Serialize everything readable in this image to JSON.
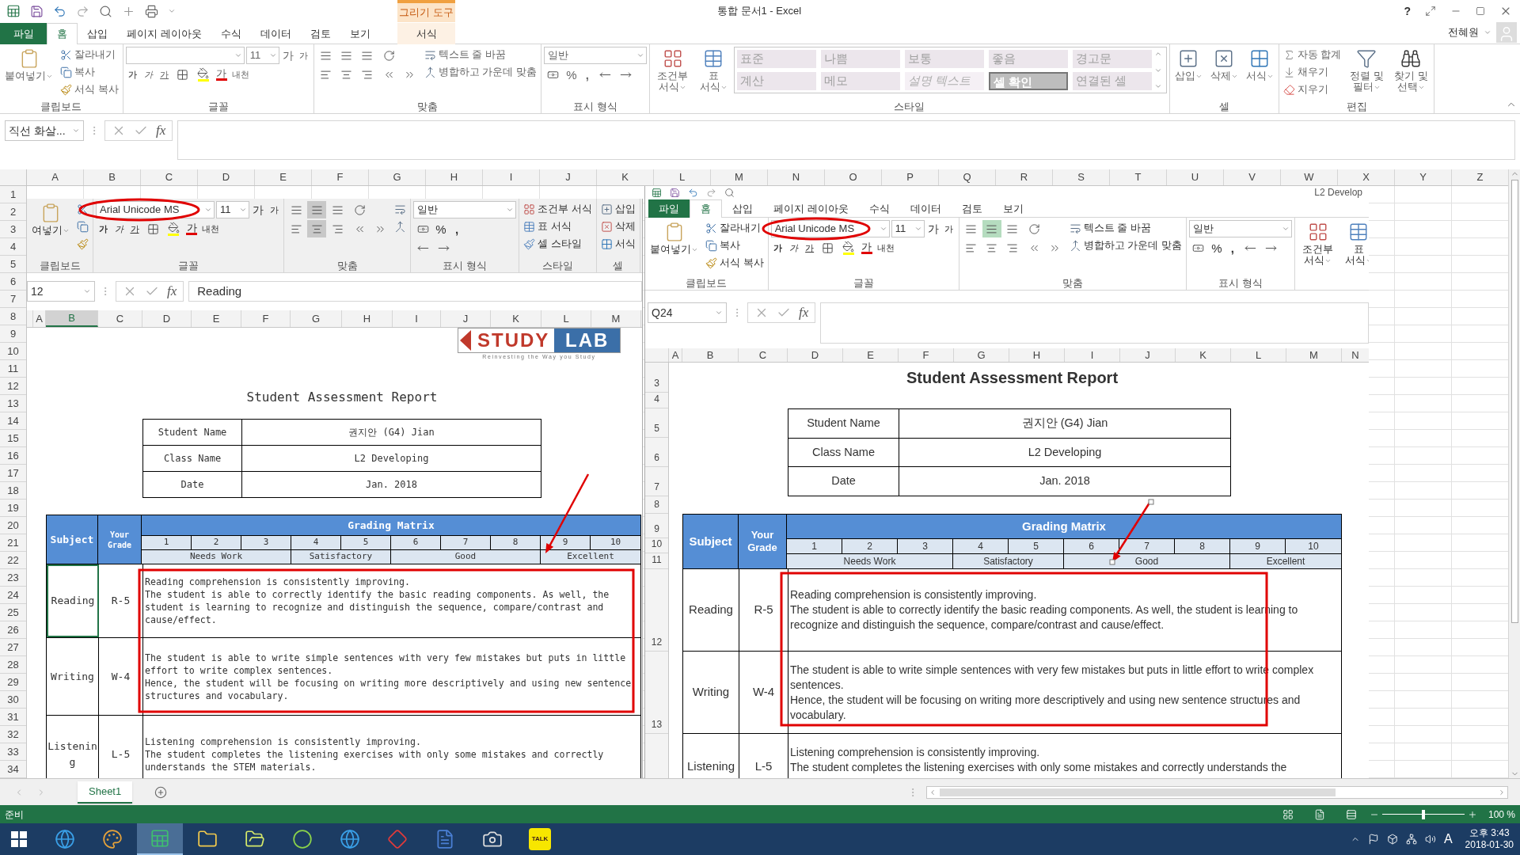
{
  "title_bar": {
    "contextual_group": "그리기 도구",
    "title": "통합 문서1 - Excel",
    "help": "?",
    "user": "전혜원"
  },
  "tabs": [
    {
      "label": "파일",
      "kind": "file",
      "selected": false
    },
    {
      "label": "홈",
      "kind": "normal",
      "selected": true
    },
    {
      "label": "삽입",
      "kind": "normal",
      "selected": false
    },
    {
      "label": "페이지 레이아웃",
      "kind": "normal",
      "selected": false
    },
    {
      "label": "수식",
      "kind": "normal",
      "selected": false
    },
    {
      "label": "데이터",
      "kind": "normal",
      "selected": false
    },
    {
      "label": "검토",
      "kind": "normal",
      "selected": false
    },
    {
      "label": "보기",
      "kind": "normal",
      "selected": false
    },
    {
      "label": "서식",
      "kind": "contextual",
      "selected": false
    }
  ],
  "ribbon": {
    "groups": [
      {
        "label": "클립보드",
        "cols": [
          [
            [
              {
                "kind": "paste",
                "label": "붙여넣기"
              }
            ]
          ],
          [
            [
              {
                "kind": "cut",
                "label": "잘라내기"
              }
            ],
            [
              {
                "kind": "copy",
                "label": "복사"
              }
            ],
            [
              {
                "kind": "painter",
                "label": "서식 복사"
              }
            ]
          ]
        ]
      },
      {
        "label": "글꼴",
        "cols": [
          [
            [
              {
                "kind": "font-box"
              },
              {
                "kind": "size-box",
                "value": "11"
              },
              {
                "kind": "grow",
                "label": "가"
              },
              {
                "kind": "shrink",
                "label": "가"
              }
            ],
            [
              {
                "kind": "bold",
                "label": "가"
              },
              {
                "kind": "italic",
                "label": "가"
              },
              {
                "kind": "underline",
                "label": "가"
              },
              {
                "kind": "borders"
              },
              {
                "kind": "fill-color"
              },
              {
                "kind": "font-color",
                "label": "가"
              },
              {
                "kind": "phonetic",
                "label": "내천"
              }
            ]
          ]
        ]
      },
      {
        "label": "맞춤",
        "cols": [
          [
            [
              {
                "kind": "align-top",
                "selected": false
              },
              {
                "kind": "align-middle",
                "selected": false
              },
              {
                "kind": "align-bottom",
                "selected": false
              }
            ],
            [
              {
                "kind": "align-left",
                "selected": false
              },
              {
                "kind": "align-center",
                "selected": false
              },
              {
                "kind": "align-right",
                "selected": false
              }
            ]
          ],
          [
            [
              {
                "kind": "orient"
              }
            ],
            [
              {
                "kind": "indent-dec"
              },
              {
                "kind": "indent-inc"
              }
            ]
          ],
          [
            [
              {
                "kind": "wrap",
                "label": "텍스트 줄 바꿈"
              }
            ],
            [
              {
                "kind": "merge",
                "label": "병합하고 가운데 맞춤"
              }
            ]
          ]
        ]
      },
      {
        "label": "표시 형식",
        "cols": [
          [
            [
              {
                "kind": "number-box",
                "value": "일반"
              }
            ],
            [
              {
                "kind": "currency"
              },
              {
                "kind": "percent",
                "label": "%"
              },
              {
                "kind": "comma",
                "label": ","
              },
              {
                "kind": "dec-inc"
              },
              {
                "kind": "dec-dec"
              }
            ]
          ]
        ]
      },
      {
        "label": "스타일",
        "cols": [
          [
            [
              {
                "kind": "cond",
                "label": "조건부 서식"
              }
            ]
          ],
          [
            [
              {
                "kind": "table-fmt",
                "label": "표 서식"
              }
            ]
          ],
          [
            [
              {
                "kind": "gallery",
                "styles": [
                  {
                    "label": "표준",
                    "kind": "plain"
                  },
                  {
                    "label": "나쁨",
                    "kind": "plain"
                  },
                  {
                    "label": "보통",
                    "kind": "plain"
                  },
                  {
                    "label": "좋음",
                    "kind": "plain"
                  },
                  {
                    "label": "경고문",
                    "kind": "plain"
                  },
                  {
                    "label": "계산",
                    "kind": "plain"
                  },
                  {
                    "label": "메모",
                    "kind": "plain"
                  },
                  {
                    "label": "설명 텍스트",
                    "kind": "italic"
                  },
                  {
                    "label": "셀 확인",
                    "kind": "check"
                  },
                  {
                    "label": "연결된 셀",
                    "kind": "plain"
                  }
                ]
              }
            ]
          ]
        ]
      },
      {
        "label": "셀",
        "cols": [
          [
            [
              {
                "kind": "insert",
                "label": "삽입"
              }
            ]
          ],
          [
            [
              {
                "kind": "delete",
                "label": "삭제"
              }
            ]
          ],
          [
            [
              {
                "kind": "format",
                "label": "서식"
              }
            ]
          ]
        ]
      },
      {
        "label": "편집",
        "cols": [
          [
            [
              {
                "kind": "autosum",
                "label": "자동 합계"
              }
            ],
            [
              {
                "kind": "fill",
                "label": "채우기"
              }
            ],
            [
              {
                "kind": "clear",
                "label": "지우기"
              }
            ]
          ],
          [
            [
              {
                "kind": "sort",
                "label": "정렬 및 필터"
              }
            ]
          ],
          [
            [
              {
                "kind": "find",
                "label": "찾기 및 선택"
              }
            ]
          ]
        ]
      }
    ]
  },
  "formula_bar": {
    "name_box": "직선 화살...",
    "function_label": "fx"
  },
  "sheet": {
    "columns": [
      "A",
      "B",
      "C",
      "D",
      "E",
      "F",
      "G",
      "H",
      "I",
      "J",
      "K",
      "L",
      "M",
      "N",
      "O",
      "P",
      "Q",
      "R",
      "S",
      "T",
      "U",
      "V",
      "W",
      "X",
      "Y",
      "Z"
    ],
    "rows": [
      "1",
      "2",
      "3",
      "4",
      "5",
      "6",
      "7",
      "8",
      "9",
      "10",
      "11",
      "12",
      "13",
      "14",
      "15",
      "16",
      "17",
      "18",
      "19",
      "20",
      "21",
      "22",
      "23",
      "24",
      "25",
      "26",
      "27",
      "28",
      "29",
      "30",
      "31",
      "32",
      "33",
      "34"
    ]
  },
  "left_screenshot": {
    "ribbon": {
      "groups": [
        {
          "label": "클립보드",
          "cols": [
            [
              [
                {
                  "kind": "paste",
                  "label": "여넣기"
                }
              ]
            ],
            [
              [
                {
                  "kind": "cut"
                }
              ],
              [
                {
                  "kind": "copy"
                }
              ],
              [
                {
                  "kind": "painter"
                }
              ]
            ]
          ]
        },
        {
          "label": "글꼴",
          "cols": [
            [
              [
                {
                  "kind": "font-box",
                  "value": "Arial Unicode MS"
                },
                {
                  "kind": "size-box",
                  "value": "11"
                },
                {
                  "kind": "grow",
                  "label": "가"
                },
                {
                  "kind": "shrink",
                  "label": "가"
                }
              ],
              [
                {
                  "kind": "bold",
                  "label": "가"
                },
                {
                  "kind": "italic",
                  "label": "가"
                },
                {
                  "kind": "underline",
                  "label": "가"
                },
                {
                  "kind": "borders"
                },
                {
                  "kind": "fill-color"
                },
                {
                  "kind": "font-color",
                  "label": "가"
                },
                {
                  "kind": "phonetic",
                  "label": "내천"
                }
              ]
            ]
          ]
        },
        {
          "label": "맞춤",
          "cols": [
            [
              [
                {
                  "kind": "align-top",
                  "selected": false
                },
                {
                  "kind": "align-middle",
                  "selected": true
                },
                {
                  "kind": "align-bottom",
                  "selected": false
                }
              ],
              [
                {
                  "kind": "align-left",
                  "selected": false
                },
                {
                  "kind": "align-center",
                  "selected": true
                },
                {
                  "kind": "align-right",
                  "selected": false
                }
              ]
            ],
            [
              [
                {
                  "kind": "orient"
                }
              ],
              [
                {
                  "kind": "indent-dec"
                },
                {
                  "kind": "indent-inc"
                }
              ]
            ],
            [
              [
                {
                  "kind": "wrap"
                }
              ],
              [
                {
                  "kind": "merge"
                }
              ]
            ]
          ]
        },
        {
          "label": "표시 형식",
          "cols": [
            [
              [
                {
                  "kind": "number-box",
                  "value": "일반"
                }
              ],
              [
                {
                  "kind": "currency"
                },
                {
                  "kind": "percent",
                  "label": "%"
                },
                {
                  "kind": "comma",
                  "label": ","
                }
              ],
              [
                {
                  "kind": "dec-inc"
                },
                {
                  "kind": "dec-dec"
                }
              ]
            ]
          ]
        },
        {
          "label": "스타일",
          "cols": [
            [
              [
                {
                  "kind": "cond-s",
                  "label": "조건부 서식"
                }
              ],
              [
                {
                  "kind": "table-s",
                  "label": "표 서식"
                }
              ],
              [
                {
                  "kind": "style-s",
                  "label": "셀 스타일"
                }
              ]
            ]
          ]
        },
        {
          "label": "셀",
          "cols": [
            [
              [
                {
                  "kind": "insert-s",
                  "label": "삽입"
                }
              ],
              [
                {
                  "kind": "delete-s",
                  "label": "삭제"
                }
              ],
              [
                {
                  "kind": "format-s",
                  "label": "서식"
                }
              ]
            ]
          ]
        }
      ]
    },
    "formula_bar": {
      "name_box": "12",
      "function_label": "fx",
      "value": "Reading"
    },
    "columns": [
      {
        "label": "A",
        "selected": false
      },
      {
        "label": "B",
        "selected": true
      },
      {
        "label": "C",
        "selected": false
      },
      {
        "label": "D",
        "selected": false
      },
      {
        "label": "E",
        "selected": false
      },
      {
        "label": "F",
        "selected": false
      },
      {
        "label": "G",
        "selected": false
      },
      {
        "label": "H",
        "selected": false
      },
      {
        "label": "I",
        "selected": false
      },
      {
        "label": "J",
        "selected": false
      },
      {
        "label": "K",
        "selected": false
      },
      {
        "label": "L",
        "selected": false
      },
      {
        "label": "M",
        "selected": false
      }
    ],
    "logo": {
      "word_1": "STUDY",
      "word_2": "LAB",
      "tagline": "Reinvesting the Way you Study"
    },
    "report": {
      "title": "Student Assessment Report",
      "info": [
        {
          "label": "Student Name",
          "value": "권지안 (G4) Jian"
        },
        {
          "label": "Class Name",
          "value": "L2 Developing"
        },
        {
          "label": "Date",
          "value": "Jan. 2018"
        }
      ],
      "matrix": {
        "subject_header": "Subject",
        "grade_header": "Your Grade",
        "title": "Grading Matrix",
        "bands": [
          {
            "label": "Needs Work",
            "scores": [
              "1",
              "2",
              "3"
            ]
          },
          {
            "label": "Satisfactory",
            "scores": [
              "4",
              "5"
            ]
          },
          {
            "label": "Good",
            "scores": [
              "6",
              "7",
              "8"
            ]
          },
          {
            "label": "Excellent",
            "scores": [
              "9",
              "10"
            ]
          }
        ]
      },
      "subjects": [
        {
          "name": "Reading",
          "grade": "R-5",
          "selected": true,
          "comment": "Reading comprehension is consistently improving.\nThe student is able to correctly identify the basic reading components. As well, the student is learning to recognize and distinguish the sequence, compare/contrast and cause/effect."
        },
        {
          "name": "Writing",
          "grade": "W-4",
          "selected": false,
          "comment": "The student is able to write simple sentences with very few mistakes but puts in little effort to write complex sentences.\nHence, the student will be focusing on writing more descriptively and using new sentence structures and vocabulary."
        },
        {
          "name": "Listening",
          "grade": "L-5",
          "selected": false,
          "comment": "Listening comprehension is consistently improving.\nThe student completes the listening exercises with only some mistakes and correctly understands the STEM materials."
        }
      ]
    }
  },
  "right_screenshot": {
    "window_text": "L2 Develop",
    "tabs": [
      {
        "label": "파일",
        "kind": "file",
        "selected": false
      },
      {
        "label": "홈",
        "kind": "normal",
        "selected": true
      },
      {
        "label": "삽입",
        "kind": "normal",
        "selected": false
      },
      {
        "label": "페이지 레이아웃",
        "kind": "normal",
        "selected": false
      },
      {
        "label": "수식",
        "kind": "normal",
        "selected": false
      },
      {
        "label": "데이터",
        "kind": "normal",
        "selected": false
      },
      {
        "label": "검토",
        "kind": "normal",
        "selected": false
      },
      {
        "label": "보기",
        "kind": "normal",
        "selected": false
      }
    ],
    "ribbon": {
      "groups": [
        {
          "label": "클립보드",
          "cols": [
            [
              [
                {
                  "kind": "paste",
                  "label": "붙여넣기"
                }
              ]
            ],
            [
              [
                {
                  "kind": "cut",
                  "label": "잘라내기"
                }
              ],
              [
                {
                  "kind": "copy",
                  "label": "복사"
                }
              ],
              [
                {
                  "kind": "painter",
                  "label": "서식 복사"
                }
              ]
            ]
          ]
        },
        {
          "label": "글꼴",
          "cols": [
            [
              [
                {
                  "kind": "font-box",
                  "value": "Arial Unicode MS"
                },
                {
                  "kind": "size-box",
                  "value": "11"
                },
                {
                  "kind": "grow",
                  "label": "가"
                },
                {
                  "kind": "shrink",
                  "label": "가"
                }
              ],
              [
                {
                  "kind": "bold",
                  "label": "가"
                },
                {
                  "kind": "italic",
                  "label": "가"
                },
                {
                  "kind": "underline",
                  "label": "가"
                },
                {
                  "kind": "borders"
                },
                {
                  "kind": "fill-color"
                },
                {
                  "kind": "font-color",
                  "label": "가"
                },
                {
                  "kind": "phonetic",
                  "label": "내천"
                }
              ]
            ]
          ]
        },
        {
          "label": "맞춤",
          "cols": [
            [
              [
                {
                  "kind": "align-top",
                  "selected": false
                },
                {
                  "kind": "align-middle",
                  "selected": true
                },
                {
                  "kind": "align-bottom",
                  "selected": false
                }
              ],
              [
                {
                  "kind": "align-left",
                  "selected": false
                },
                {
                  "kind": "align-center",
                  "selected": false
                },
                {
                  "kind": "align-right",
                  "selected": false
                }
              ]
            ],
            [
              [
                {
                  "kind": "orient"
                }
              ],
              [
                {
                  "kind": "indent-dec"
                },
                {
                  "kind": "indent-inc"
                }
              ]
            ],
            [
              [
                {
                  "kind": "wrap",
                  "label": "텍스트 줄 바꿈"
                }
              ],
              [
                {
                  "kind": "merge",
                  "label": "병합하고 가운데 맞춤"
                }
              ]
            ]
          ]
        },
        {
          "label": "표시 형식",
          "cols": [
            [
              [
                {
                  "kind": "number-box",
                  "value": "일반"
                }
              ],
              [
                {
                  "kind": "currency"
                },
                {
                  "kind": "percent",
                  "label": "%"
                },
                {
                  "kind": "comma",
                  "label": ","
                },
                {
                  "kind": "dec-inc"
                },
                {
                  "kind": "dec-dec"
                }
              ]
            ]
          ]
        },
        {
          "cols": [
            [
              [
                {
                  "kind": "cond",
                  "label": "조건부 서식"
                }
              ]
            ],
            [
              [
                {
                  "kind": "table-fmt",
                  "label": "표 서식"
                }
              ]
            ]
          ]
        }
      ]
    },
    "formula_bar": {
      "name_box": "Q24",
      "function_label": "fx"
    },
    "columns": [
      {
        "label": "A",
        "selected": false
      },
      {
        "label": "B",
        "selected": false
      },
      {
        "label": "C",
        "selected": false
      },
      {
        "label": "D",
        "selected": false
      },
      {
        "label": "E",
        "selected": false
      },
      {
        "label": "F",
        "selected": false
      },
      {
        "label": "G",
        "selected": false
      },
      {
        "label": "H",
        "selected": false
      },
      {
        "label": "I",
        "selected": false
      },
      {
        "label": "J",
        "selected": false
      },
      {
        "label": "K",
        "selected": false
      },
      {
        "label": "L",
        "selected": false
      },
      {
        "label": "M",
        "selected": false
      },
      {
        "label": "N",
        "selected": false
      }
    ],
    "rows": [
      "3",
      "4",
      "5",
      "6",
      "7",
      "8",
      "9",
      "10",
      "11",
      "12",
      "13"
    ],
    "report": {
      "title": "Student Assessment Report",
      "info": [
        {
          "label": "Student Name",
          "value": "권지안 (G4) Jian"
        },
        {
          "label": "Class Name",
          "value": "L2 Developing"
        },
        {
          "label": "Date",
          "value": "Jan. 2018"
        }
      ],
      "matrix": {
        "subject_header": "Subject",
        "grade_header": "Your Grade",
        "title": "Grading Matrix",
        "bands": [
          {
            "label": "Needs Work",
            "scores": [
              "1",
              "2",
              "3"
            ]
          },
          {
            "label": "Satisfactory",
            "scores": [
              "4",
              "5"
            ]
          },
          {
            "label": "Good",
            "scores": [
              "6",
              "7",
              "8"
            ]
          },
          {
            "label": "Excellent",
            "scores": [
              "9",
              "10"
            ]
          }
        ]
      },
      "subjects": [
        {
          "name": "Reading",
          "grade": "R-5",
          "comment": "Reading comprehension is consistently improving.\nThe student is able to correctly identify the basic reading components. As well, the student is learning to recognize and distinguish the sequence, compare/contrast and cause/effect."
        },
        {
          "name": "Writing",
          "grade": "W-4",
          "comment": "The student is able to write simple sentences with very few mistakes but puts in little effort to write complex sentences.\nHence, the student will be focusing on writing more descriptively and using new sentence structures and vocabulary."
        },
        {
          "name": "Listening",
          "grade": "L-5",
          "comment": "Listening comprehension is consistently improving.\nThe student completes the listening exercises with only some mistakes and correctly understands the"
        }
      ]
    }
  },
  "sheet_tabs": [
    {
      "label": "Sheet1",
      "selected": true
    }
  ],
  "status_bar": {
    "status": "준비",
    "zoom": {
      "level": 0.5,
      "reading": "100 %"
    }
  },
  "taskbar": {
    "apps": [
      {
        "selected": false
      },
      {
        "selected": false
      },
      {
        "selected": true
      },
      {
        "selected": false
      },
      {
        "selected": false
      },
      {
        "selected": false
      },
      {
        "selected": false
      },
      {
        "selected": false
      },
      {
        "selected": false
      },
      {
        "selected": false
      },
      {
        "selected": false,
        "label": "TALK"
      }
    ],
    "ime": "A",
    "time": "오후 3:43",
    "date": "2018-01-30"
  }
}
